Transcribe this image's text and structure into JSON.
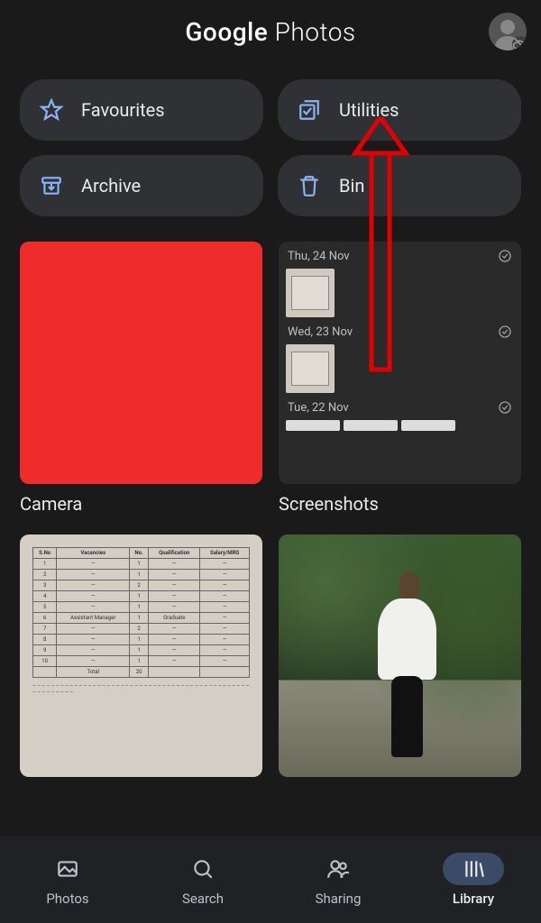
{
  "header": {
    "title_main": "Google",
    "title_sub": "Photos"
  },
  "chips": {
    "favourites": "Favourites",
    "utilities": "Utilities",
    "archive": "Archive",
    "bin": "Bin"
  },
  "camera_album": {
    "label": "Camera"
  },
  "screenshots_album": {
    "label": "Screenshots",
    "dates": [
      "Thu, 24 Nov",
      "Wed, 23 Nov",
      "Tue, 22 Nov"
    ]
  },
  "nav": {
    "photos": "Photos",
    "search": "Search",
    "sharing": "Sharing",
    "library": "Library"
  }
}
